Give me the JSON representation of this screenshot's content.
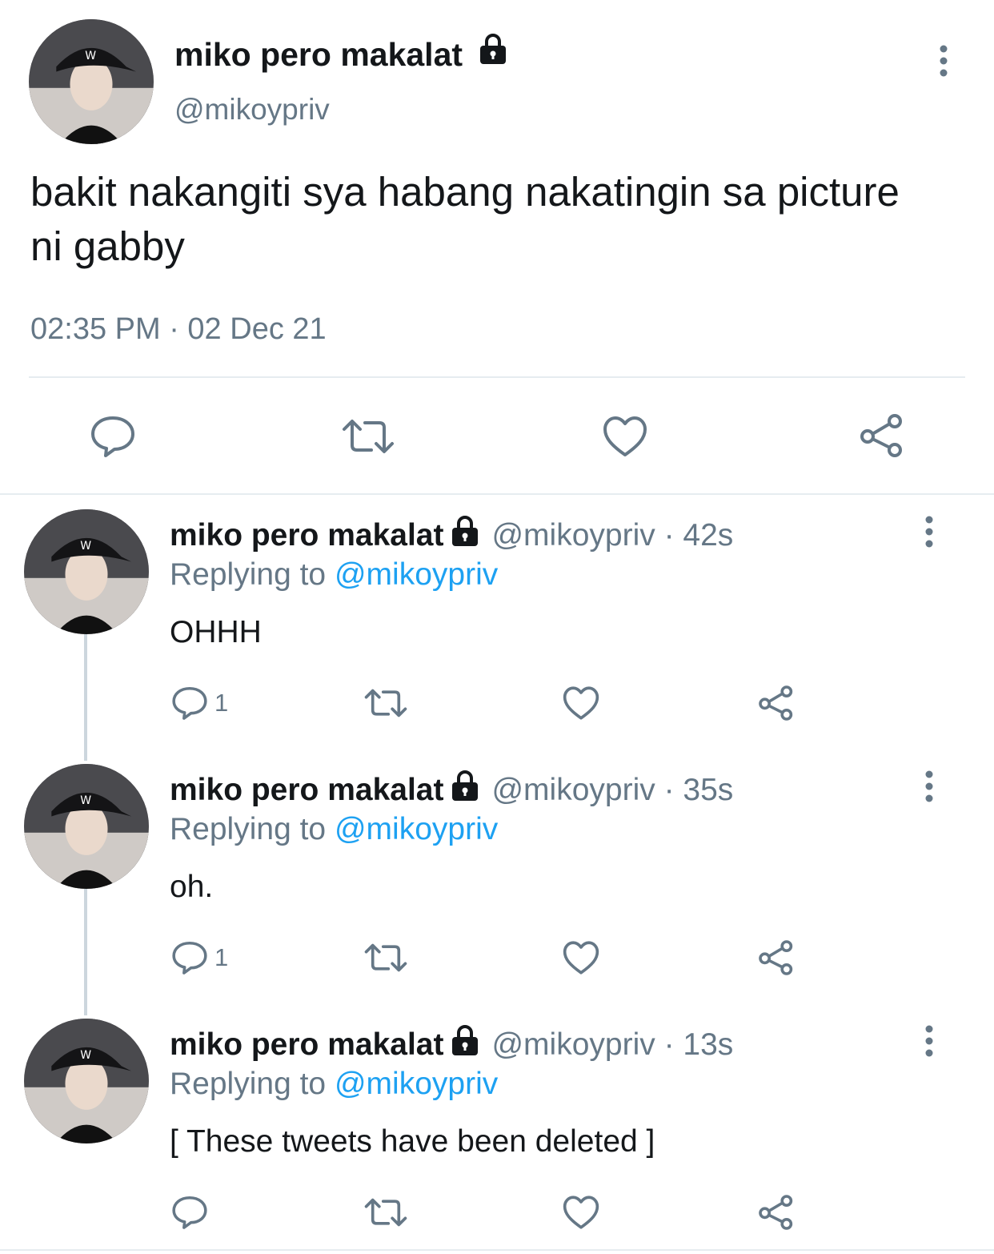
{
  "main_tweet": {
    "name": "miko pero makalat",
    "handle": "@mikoypriv",
    "text": "bakit nakangiti sya habang nakatingin sa picture ni gabby",
    "timestamp": "02:35 PM · 02 Dec 21",
    "icons": [
      "reply-icon",
      "retweet-icon",
      "like-icon",
      "share-icon",
      "more-icon",
      "lock-icon"
    ]
  },
  "replies": [
    {
      "name": "miko pero makalat",
      "handle_time": "@mikoypriv · 42s",
      "replying_prefix": "Replying to",
      "replying_to": "@mikoypriv",
      "text": "OHHH",
      "reply_count": "1"
    },
    {
      "name": "miko pero makalat",
      "handle_time": "@mikoypriv · 35s",
      "replying_prefix": "Replying to",
      "replying_to": "@mikoypriv",
      "text": "oh.",
      "reply_count": "1"
    },
    {
      "name": "miko pero makalat",
      "handle_time": "@mikoypriv · 13s",
      "replying_prefix": "Replying to",
      "replying_to": "@mikoypriv",
      "text": "[ These tweets have been deleted ]",
      "reply_count": ""
    }
  ],
  "colors": {
    "text": "#14171a",
    "secondary": "#657786",
    "link": "#1da1f2",
    "divider": "#e6ecf0",
    "thread": "#ccd6dd"
  }
}
